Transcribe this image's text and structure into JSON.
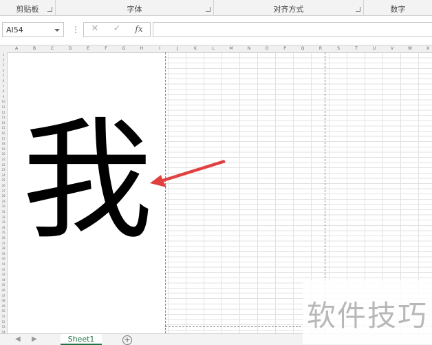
{
  "ribbon": {
    "groups": [
      {
        "label": "剪贴板"
      },
      {
        "label": "字体"
      },
      {
        "label": "对齐方式"
      },
      {
        "label": "数字"
      }
    ]
  },
  "formula_bar": {
    "name_box": "AI54",
    "cancel_icon": "✕",
    "enter_icon": "✓",
    "fx_label": "fx",
    "formula_value": ""
  },
  "sheet": {
    "columns": [
      "A",
      "B",
      "C",
      "D",
      "E",
      "F",
      "G",
      "H",
      "I",
      "J",
      "K",
      "L",
      "M",
      "N",
      "O",
      "P",
      "Q",
      "R",
      "S",
      "T",
      "U",
      "V",
      "W",
      "X"
    ],
    "big_character": "我",
    "arrow_color": "#e04040"
  },
  "tabs": {
    "prev_icon": "◀",
    "next_icon": "▶",
    "active_sheet": "Sheet1",
    "add_icon": "+"
  },
  "watermark": {
    "text": "软件技巧"
  }
}
